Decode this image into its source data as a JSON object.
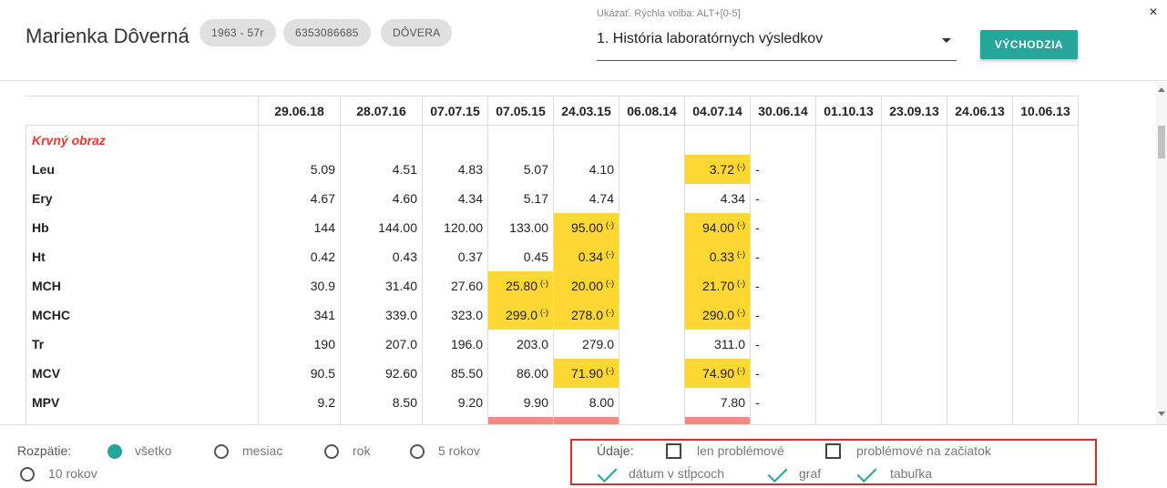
{
  "patient": {
    "name": "Marienka Dôverná",
    "chips": [
      "1963 - 57r",
      "6353086685",
      "DÔVERA"
    ]
  },
  "quick_select": {
    "label": "Ukázať. Rýchla volba: ALT+[0-5]",
    "value": "1. História laboratórnych výsledkov"
  },
  "buttons": {
    "default": "VÝCHODZIA",
    "close": "×"
  },
  "table": {
    "dates": [
      "29.06.18",
      "28.07.16",
      "07.07.15",
      "07.05.15",
      "24.03.15",
      "06.08.14",
      "04.07.14",
      "30.06.14",
      "01.10.13",
      "23.09.13",
      "24.06.13",
      "10.06.13"
    ],
    "section_title": "Krvný obraz",
    "flag_symbol": "(-)",
    "rows": [
      {
        "name": "Leu",
        "values": [
          "5.09",
          "4.51",
          "4.83",
          "5.07",
          "4.10",
          "",
          "3.72",
          "-",
          "",
          "",
          "",
          ""
        ],
        "flags": [
          6
        ]
      },
      {
        "name": "Ery",
        "values": [
          "4.67",
          "4.60",
          "4.34",
          "5.17",
          "4.74",
          "",
          "4.34",
          "-",
          "",
          "",
          "",
          ""
        ],
        "flags": []
      },
      {
        "name": "Hb",
        "values": [
          "144",
          "144.00",
          "120.00",
          "133.00",
          "95.00",
          "",
          "94.00",
          "-",
          "",
          "",
          "",
          ""
        ],
        "flags": [
          4,
          6
        ]
      },
      {
        "name": "Ht",
        "values": [
          "0.42",
          "0.43",
          "0.37",
          "0.45",
          "0.34",
          "",
          "0.33",
          "-",
          "",
          "",
          "",
          ""
        ],
        "flags": [
          4,
          6
        ]
      },
      {
        "name": "MCH",
        "values": [
          "30.9",
          "31.40",
          "27.60",
          "25.80",
          "20.00",
          "",
          "21.70",
          "-",
          "",
          "",
          "",
          ""
        ],
        "flags": [
          3,
          4,
          6
        ]
      },
      {
        "name": "MCHC",
        "values": [
          "341",
          "339.0",
          "323.0",
          "299.0",
          "278.0",
          "",
          "290.0",
          "-",
          "",
          "",
          "",
          ""
        ],
        "flags": [
          3,
          4,
          6
        ]
      },
      {
        "name": "Tr",
        "values": [
          "190",
          "207.0",
          "196.0",
          "203.0",
          "279.0",
          "",
          "311.0",
          "-",
          "",
          "",
          "",
          ""
        ],
        "flags": []
      },
      {
        "name": "MCV",
        "values": [
          "90.5",
          "92.60",
          "85.50",
          "86.00",
          "71.90",
          "",
          "74.90",
          "-",
          "",
          "",
          "",
          ""
        ],
        "flags": [
          4,
          6
        ]
      },
      {
        "name": "MPV",
        "values": [
          "9.2",
          "8.50",
          "9.20",
          "9.90",
          "8.00",
          "",
          "7.80",
          "-",
          "",
          "",
          "",
          ""
        ],
        "flags": []
      }
    ],
    "partial_row_red_cols": [
      3,
      4,
      6
    ],
    "highlight_color": "#fdd835",
    "alert_color": "#f28b82"
  },
  "footer": {
    "range_label": "Rozpätie:",
    "range_options": [
      "všetko",
      "mesiac",
      "rok",
      "5 rokov",
      "10 rokov"
    ],
    "range_selected": "všetko",
    "data_label": "Údaje:",
    "checkboxes": [
      {
        "label": "len problémové",
        "checked": false
      },
      {
        "label": "problémové na začiatok",
        "checked": false
      },
      {
        "label": "dátum v stĺpcoch",
        "checked": true
      },
      {
        "label": "graf",
        "checked": true
      },
      {
        "label": "tabuľka",
        "checked": true
      }
    ],
    "accent": "#26a69a"
  }
}
